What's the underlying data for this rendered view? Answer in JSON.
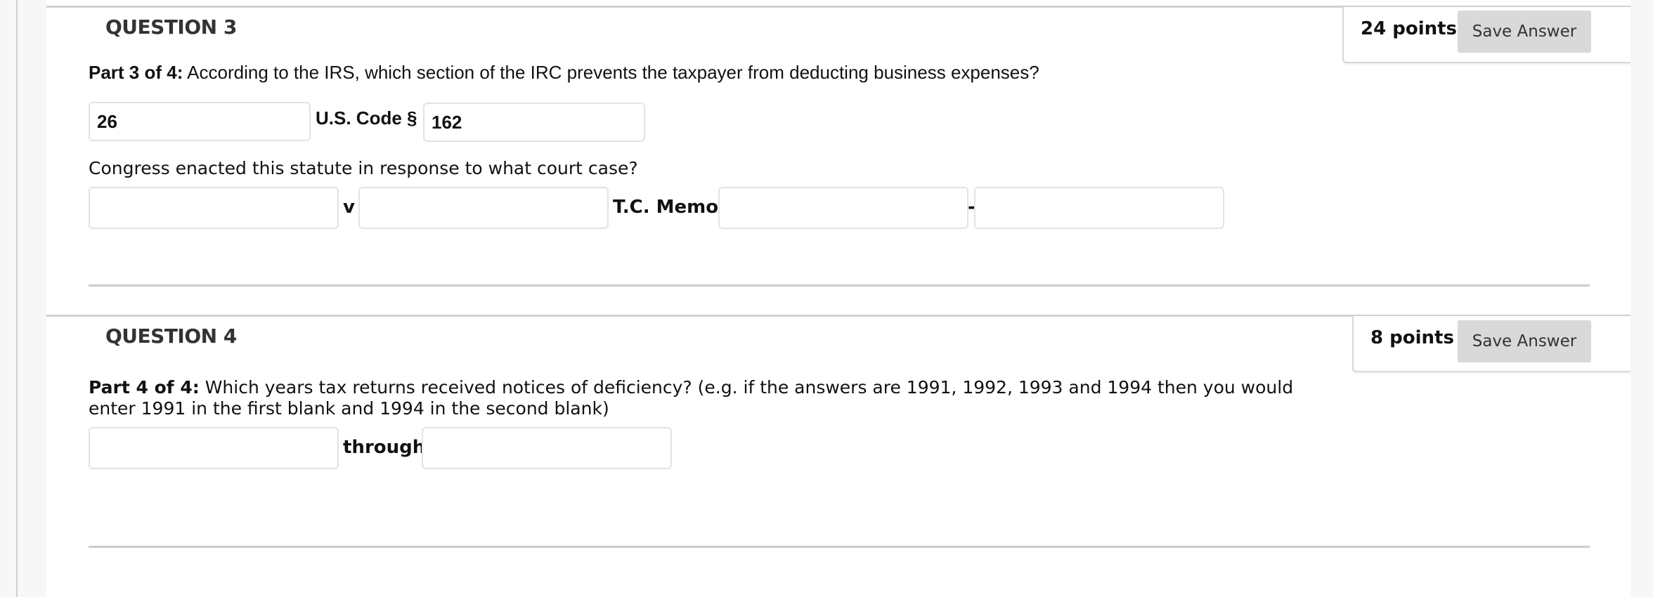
{
  "questions": [
    {
      "title": "QUESTION 3",
      "points": "24 points",
      "save_label": "Save Answer",
      "part_label": "Part 3 of 4:",
      "prompt": " According to the IRS, which section of the IRC prevents the taxpayer from deducting business expenses?",
      "code_title_value": "26",
      "code_label": "U.S. Code §",
      "code_section_value": "162",
      "followup": "Congress enacted this statute in response to what court case?",
      "case_party1_value": "",
      "versus_label": "v",
      "case_party2_value": "",
      "memo_label": "T.C. Memo.",
      "memo_year_value": "",
      "dash_label": "-",
      "memo_number_value": ""
    },
    {
      "title": "QUESTION 4",
      "points": "8 points",
      "save_label": "Save Answer",
      "part_label": "Part 4 of 4:",
      "prompt_line1": " Which years tax returns received notices of deficiency? (e.g. if the answers are 1991, 1992, 1993 and 1994 then you would",
      "prompt_line2": "enter 1991 in the first blank and 1994 in the second blank)",
      "start_year_value": "",
      "through_label": "through",
      "end_year_value": ""
    }
  ]
}
